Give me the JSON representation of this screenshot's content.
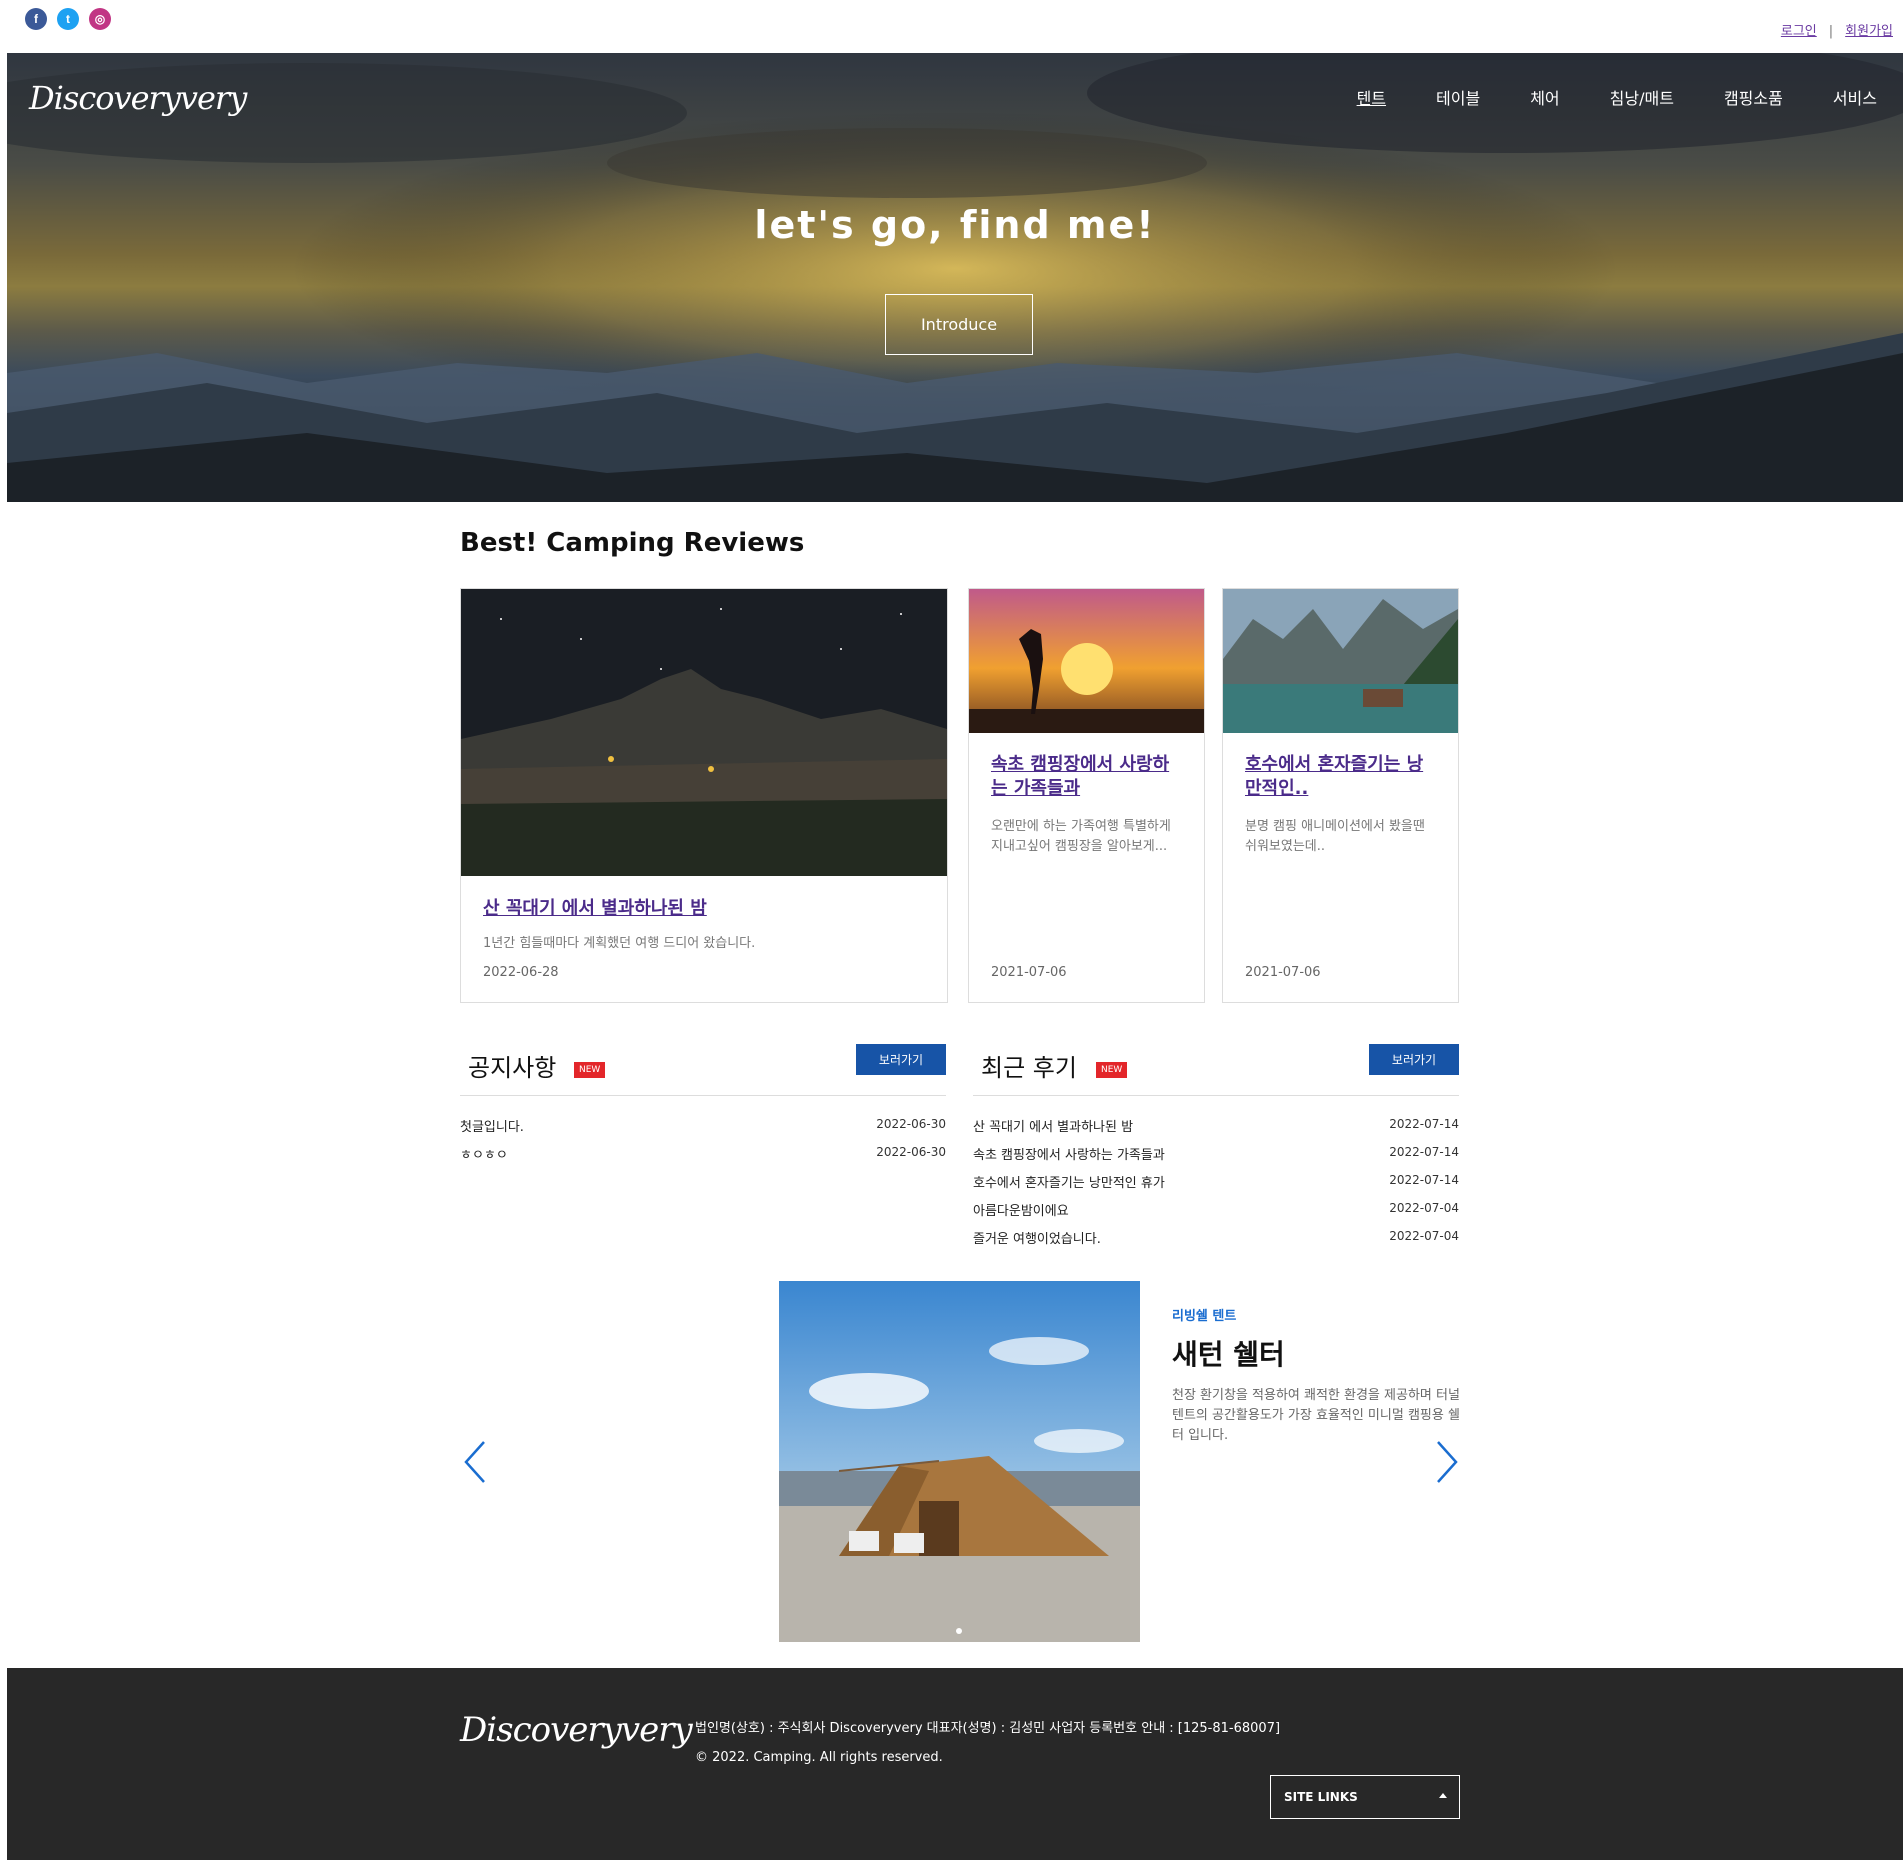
{
  "topbar": {
    "social": [
      {
        "name": "facebook-icon",
        "glyph": "f"
      },
      {
        "name": "twitter-icon",
        "glyph": "t"
      },
      {
        "name": "instagram-icon",
        "glyph": "◎"
      }
    ],
    "login": "로그인",
    "separator": "|",
    "signup": "회원가입"
  },
  "header": {
    "logo": "Discoveryvery",
    "nav": [
      "텐트",
      "테이블",
      "체어",
      "침낭/매트",
      "캠핑소품",
      "서비스"
    ],
    "active_nav": 0
  },
  "hero": {
    "title": "let's go, find me!",
    "button": "Introduce"
  },
  "reviews": {
    "section_title": "Best! Camping Reviews",
    "cards": [
      {
        "title": "산 꼭대기 에서 별과하나된 밤",
        "desc": "1년간 힘들때마다 계획했던 여행 드디어 왔습니다.",
        "date": "2022-06-28"
      },
      {
        "title": "속초 캠핑장에서 사랑하는 가족들과",
        "desc": "오랜만에 하는 가족여행 특별하게 지내고싶어 캠핑장을 알아보게...",
        "date": "2021-07-06"
      },
      {
        "title": "호수에서 혼자즐기는 낭만적인..",
        "desc": "분명 캠핑 애니메이션에서 봤을땐 쉬워보였는데..",
        "date": "2021-07-06"
      }
    ]
  },
  "notice": {
    "title": "공지사항",
    "badge": "NEW",
    "button": "보러가기",
    "items": [
      {
        "text": "첫글입니다.",
        "date": "2022-06-30"
      },
      {
        "text": "ㅎㅇㅎㅇ",
        "date": "2022-06-30"
      }
    ]
  },
  "recent": {
    "title": "최근 후기",
    "badge": "NEW",
    "button": "보러가기",
    "items": [
      {
        "text": "산 꼭대기 에서 별과하나된 밤",
        "date": "2022-07-14"
      },
      {
        "text": "속초 캠핑장에서 사랑하는 가족들과",
        "date": "2022-07-14"
      },
      {
        "text": "호수에서 혼자즐기는 낭만적인 휴가",
        "date": "2022-07-14"
      },
      {
        "text": "아름다운밤이에요",
        "date": "2022-07-04"
      },
      {
        "text": "즐거운 여행이었습니다.",
        "date": "2022-07-04"
      }
    ]
  },
  "slider": {
    "subtitle": "리빙쉘 텐트",
    "title": "새턴 쉘터",
    "desc": "천장 환기창을 적용하여 쾌적한 환경을 제공하며 터널 텐트의 공간활용도가 가장 효율적인 미니멀 캠핑용 쉘터 입니다."
  },
  "footer": {
    "logo": "Discoveryvery",
    "info": "법인명(상호) : 주식회사 Discoveryvery 대표자(성명) : 김성민 사업자 등록번호 안내 : [125-81-68007]",
    "copyright": "© 2022. Camping. All rights reserved.",
    "site_links": "SITE LINKS"
  },
  "colors": {
    "accent": "#1754a7",
    "badge": "#e3262a",
    "link": "#4b2b8a",
    "footer_bg": "#282828"
  }
}
